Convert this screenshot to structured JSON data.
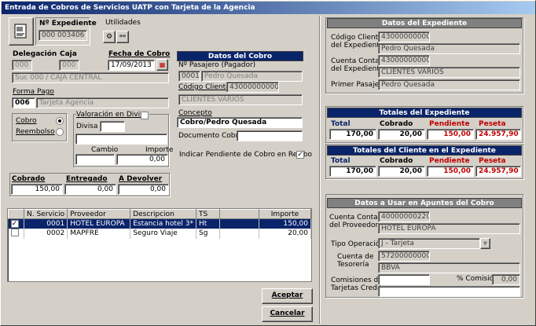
{
  "window": {
    "title": "Entrada de Cobros de Servicios UATP con Tarjeta de la Agencia"
  },
  "expediente": {
    "label": "Nº Expediente",
    "value": "000 003406"
  },
  "utilidades": {
    "label": "Utilidades"
  },
  "delegacion": {
    "label": "Delegación",
    "value": "000"
  },
  "caja": {
    "label": "Caja",
    "value": "000"
  },
  "fecha_cobro": {
    "label": "Fecha de Cobro",
    "value": "17/09/2013"
  },
  "suc_desc": "Suc 000 / CAJA CENTRAL",
  "forma_pago": {
    "label": "Forma Pago",
    "code": "006",
    "desc": "Tarjeta Agencia"
  },
  "cobro_radio": {
    "label": "Cobro",
    "selected": true
  },
  "reembolso_radio": {
    "label": "Reembolso",
    "selected": false
  },
  "divisa": {
    "valoracion_label": "Valoración en Divisa",
    "divisa_label": "Divisa",
    "cambio_label": "Cambio",
    "importe_label": "Importe",
    "importe_value": "0,00"
  },
  "totals_small": {
    "cobrado_label": "Cobrado",
    "cobrado_value": "150,00",
    "entregado_label": "Entregado",
    "entregado_value": "0,00",
    "devolver_label": "A Devolver",
    "devolver_value": "0,00"
  },
  "datos_cobro": {
    "title": "Datos del Cobro",
    "pasajero_label": "Nº Pasajero (Pagador)",
    "pasajero_num": "0001",
    "pasajero_name": "Pedro Quesada",
    "cliente_label": "Código Cliente",
    "cliente_code": "43000000000",
    "cliente_name": "CLIENTES VARIOS",
    "concepto_label": "Concepto",
    "concepto_value": "Cobro/Pedro Quesada",
    "doc_label": "Documento Cobro",
    "indicar_label": "Indicar Pendiente de Cobro en Recibo",
    "indicar_checked": "✓"
  },
  "datos_expediente": {
    "title": "Datos del Expediente",
    "cod_cliente_label1": "Código Cliente",
    "cod_cliente_label2": "del Expediente",
    "cod_cliente_value": "43000000000",
    "cod_cliente_name": "Pedro Quesada",
    "cuenta_label1": "Cuenta Contable",
    "cuenta_label2": "del Expediente",
    "cuenta_value": "43000000000",
    "cuenta_name": "CLIENTES VARIOS",
    "primer_label": "Primer Pasajero",
    "primer_value": "Pedro Quesada"
  },
  "totales_expediente": {
    "title": "Totales del Expediente",
    "total_label": "Total",
    "cobrado_label": "Cobrado",
    "pendiente_label": "Pendiente",
    "peseta_label": "Peseta",
    "total": "170,00",
    "cobrado": "20,00",
    "pendiente": "150,00",
    "peseta": "24.957,90"
  },
  "totales_cliente": {
    "title": "Totales del Cliente en el Expediente",
    "total_label": "Total",
    "cobrado_label": "Cobrado",
    "pendiente_label": "Pendiente",
    "peseta_label": "Peseta",
    "total": "170,00",
    "cobrado": "20,00",
    "pendiente": "150,00",
    "peseta": "24.957,90"
  },
  "apuntes": {
    "title": "Datos a Usar en Apuntes del Cobro",
    "cuenta_prov_label1": "Cuenta Contable",
    "cuenta_prov_label2": "del Proveedor",
    "cuenta_prov_value": "40000000220",
    "cuenta_prov_name": "HOTEL EUROPA",
    "tipo_label": "Tipo Operación",
    "tipo_value": "J - Tarjeta",
    "tesoreria_label1": "Cuenta de",
    "tesoreria_label2": "Tesorería",
    "tesoreria_value": "57200000000",
    "tesoreria_name": "BBVA",
    "comisiones_label1": "Comisiones de",
    "comisiones_label2": "Tarjetas Credito",
    "pct_label": "% Comisión",
    "pct_value": "0,00"
  },
  "grid": {
    "headers": [
      "N. Servicio",
      "Proveedor",
      "Descripcion",
      "TS",
      "",
      "Importe"
    ],
    "rows": [
      {
        "check": "✓",
        "n": "0001",
        "proveedor": "HOTEL EUROPA",
        "desc": "Estancia hotel 3*",
        "ts": "Ht",
        "importe": "150,00"
      },
      {
        "check": "",
        "n": "0002",
        "proveedor": "MAPFRE",
        "desc": "Seguro Viaje",
        "ts": "Sg",
        "importe": "20,00"
      }
    ]
  },
  "buttons": {
    "aceptar": "Aceptar",
    "cancelar": "Cancelar"
  }
}
